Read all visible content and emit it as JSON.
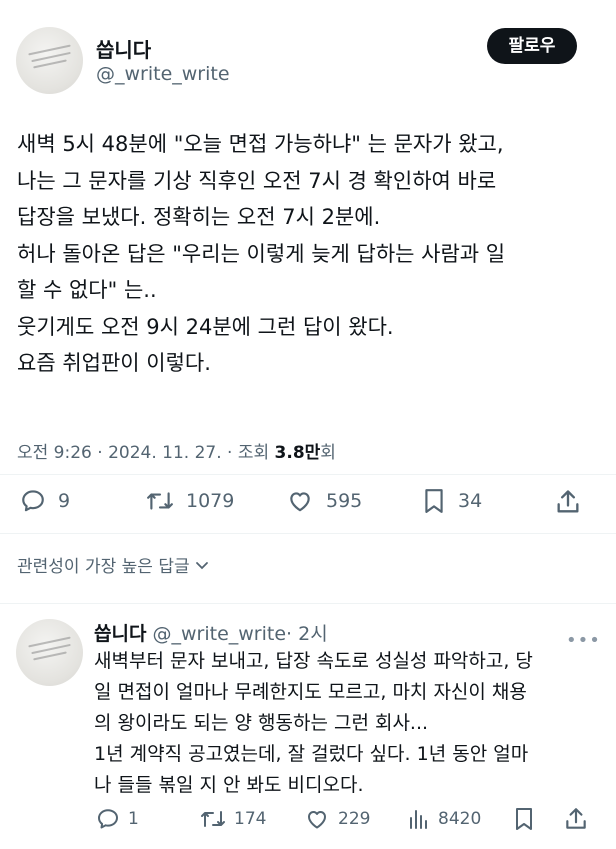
{
  "post": {
    "author": {
      "name": "씁니다",
      "handle": "@_write_write"
    },
    "follow_label": "팔로우",
    "body_lines": [
      "새벽 5시 48분에 \"오늘 면접 가능하냐\" 는 문자가 왔고,",
      "나는 그 문자를 기상 직후인 오전 7시 경 확인하여 바로",
      "답장을 보냈다. 정확히는 오전 7시 2분에.",
      "허나 돌아온 답은 \"우리는 이렇게 늦게 답하는 사람과 일",
      "할 수 없다\" 는..",
      "웃기게도 오전 9시 24분에 그런 답이 왔다.",
      "요즘 취업판이 이렇다."
    ],
    "meta": {
      "time": "오전 9:26",
      "date": "2024. 11. 27.",
      "views_label": "조회",
      "views": "3.8만",
      "views_suffix": "회",
      "sep": " · "
    },
    "actions": {
      "replies": "9",
      "reposts": "1079",
      "likes": "595",
      "bookmarks": "34"
    }
  },
  "sort_label": "관련성이 가장 높은 답글",
  "reply": {
    "author": {
      "name": "씁니다",
      "handle": "@_write_write",
      "time": "· 2시"
    },
    "more_label": "•••",
    "body_lines": [
      "새벽부터 문자 보내고, 답장 속도로 성실성 파악하고, 당",
      "일 면접이 얼마나 무례한지도 모르고, 마치 자신이 채용",
      "의 왕이라도 되는 양 행동하는 그런 회사...",
      "1년 계약직 공고였는데, 잘 걸렀다 싶다. 1년 동안 얼마",
      "나 들들 볶일 지 안 봐도 비디오다."
    ],
    "actions": {
      "replies": "1",
      "reposts": "174",
      "likes": "229",
      "views": "8420"
    }
  },
  "icons": [
    "reply-icon",
    "repost-icon",
    "like-icon",
    "bookmark-icon",
    "share-icon",
    "views-icon",
    "chevron-down-icon"
  ]
}
